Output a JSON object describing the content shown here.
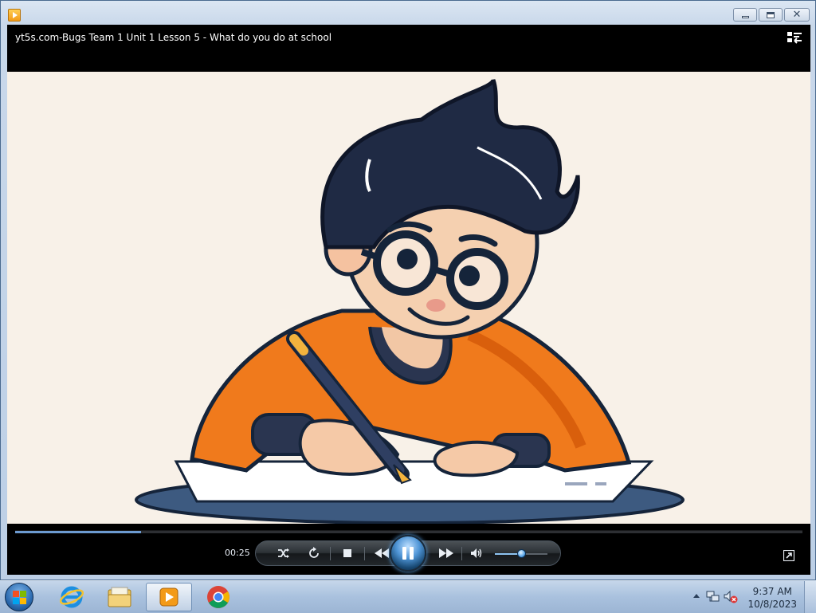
{
  "window": {
    "video_title": "yt5s.com-Bugs Team 1 Unit 1 Lesson 5 - What do you do at school"
  },
  "player": {
    "elapsed_time": "00:25",
    "progress_fraction": 0.16,
    "volume_fraction": 0.5,
    "state": "playing",
    "accent_color": "#4f95d6"
  },
  "icons": {
    "app": "media-player-icon",
    "switch_to_library": "switch-to-library-icon",
    "shuffle": "shuffle-icon",
    "repeat": "repeat-icon",
    "stop": "stop-icon",
    "previous": "previous-icon",
    "pause": "pause-icon",
    "next": "next-icon",
    "volume": "speaker-icon",
    "fullscreen": "fullscreen-icon"
  },
  "taskbar": {
    "apps": [
      "internet-explorer",
      "windows-explorer",
      "windows-media-player",
      "google-chrome"
    ],
    "clock_time": "9:37 AM",
    "clock_date": "10/8/2023"
  }
}
